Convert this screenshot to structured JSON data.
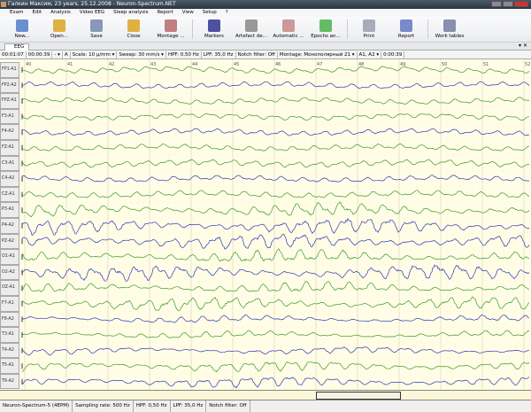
{
  "window": {
    "title": "Галкин Максим, 23 years, 25.12.2008 - Neuron-Spectrum.NET"
  },
  "menu": [
    "Exam",
    "Edit",
    "Analysis",
    "Video EEG",
    "Sleep analysis",
    "Report",
    "View",
    "Setup",
    "?"
  ],
  "toolbar": [
    {
      "label": "New...",
      "icon": "new-exam-icon",
      "color": "#6a8fd0"
    },
    {
      "label": "Open...",
      "icon": "open-folder-icon",
      "color": "#e0b040"
    },
    {
      "label": "Save",
      "icon": "save-icon",
      "color": "#8898b8"
    },
    {
      "label": "Close",
      "icon": "close-folder-icon",
      "color": "#e0b040"
    },
    {
      "label": "Montage ...",
      "icon": "montage-icon",
      "color": "#c08080"
    },
    {
      "label": "Markers",
      "icon": "flag-icon",
      "color": "#5050a0"
    },
    {
      "label": "Artefact de...",
      "icon": "artefact-icon",
      "color": "#999"
    },
    {
      "label": "Automatic ...",
      "icon": "automatic-icon",
      "color": "#c99"
    },
    {
      "label": "Epochs an...",
      "icon": "epochs-icon",
      "color": "#6b6"
    },
    {
      "label": "Print",
      "icon": "print-icon",
      "color": "#aab"
    },
    {
      "label": "Report",
      "icon": "report-icon",
      "color": "#7a8ac8"
    },
    {
      "label": "Work tables",
      "icon": "work-tables-icon",
      "color": "#8890b0"
    }
  ],
  "tab": {
    "label": "EEG"
  },
  "params": {
    "time1": "00:01:07",
    "time2": "00:00:39",
    "nav": "- ▾",
    "a": "A",
    "scale": "Scale: 10 μ/mm ▾",
    "sweep": "Sweep: 30 mm/s ▾",
    "hpf": "HPF: 0,50 Hz",
    "lpf": "LPF: 35,0 Hz",
    "notch": "Notch filter: Off",
    "montage": "Montage: Монополярный 21 ▾",
    "ref": "A1, A2 ▾",
    "time3": "0:00:39"
  },
  "seconds": [
    "40",
    "41",
    "42",
    "43",
    "44",
    "45",
    "46",
    "47",
    "48",
    "49",
    "50",
    "51",
    "52"
  ],
  "channels": [
    "FP1-A1",
    "FP2-A2",
    "FPZ-A1",
    "F3-A1",
    "F4-A2",
    "FZ-A1",
    "C3-A1",
    "C4-A2",
    "CZ-A1",
    "P3-A1",
    "P4-A2",
    "PZ-A2",
    "O1-A1",
    "O2-A2",
    "OZ-A1",
    "F7-A1",
    "F8-A2",
    "T3-A1",
    "T4-A2",
    "T5-A1",
    "T6-A2"
  ],
  "colors": {
    "a1": "#3a9a2a",
    "a2": "#3535b8",
    "background": "#fffde6"
  },
  "status": [
    "Neuron-Spectrum-5 (4EPM)",
    "Sampling rate: 500 Hz",
    "HPF: 0,50 Hz",
    "LPF: 35,0 Hz",
    "Notch filter: Off"
  ]
}
